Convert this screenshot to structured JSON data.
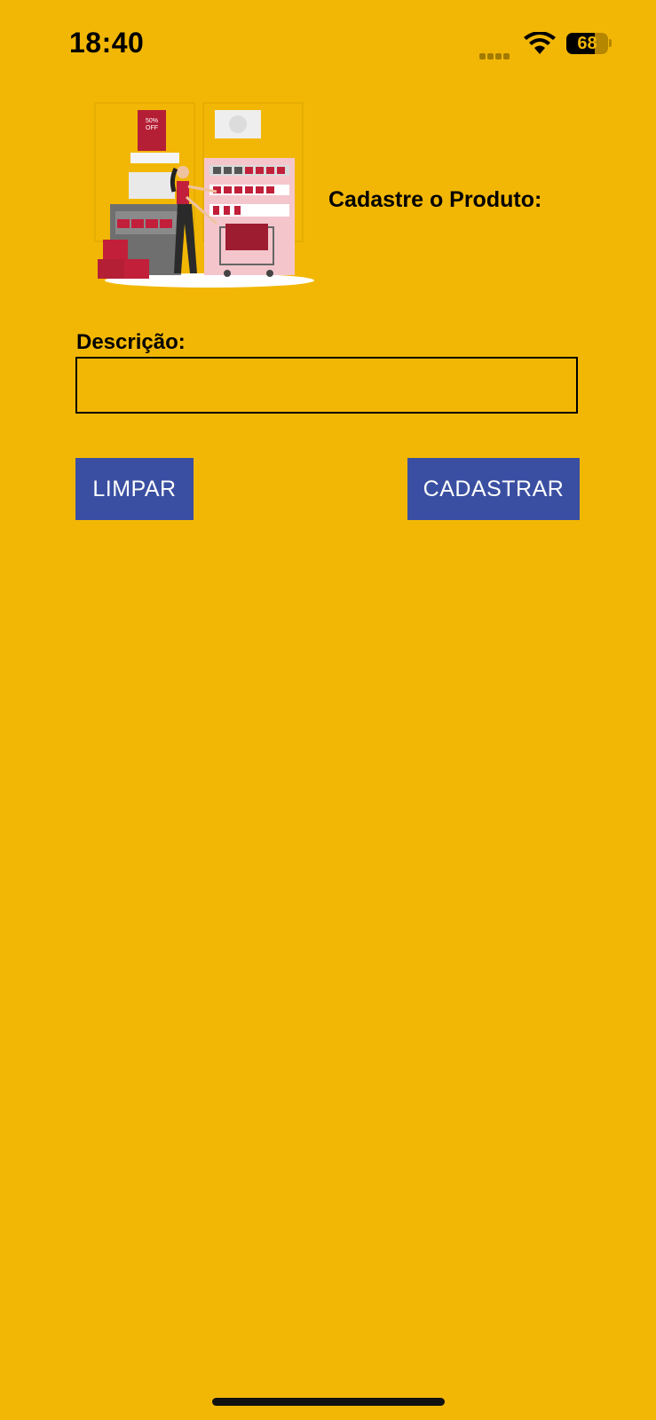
{
  "status_bar": {
    "time": "18:40",
    "battery_percent": "68",
    "icons": [
      "signal-dots-icon",
      "wifi-icon",
      "battery-icon"
    ]
  },
  "hero": {
    "icon": "shopping-illustration",
    "sign_text": "50% OFF"
  },
  "page_title": "Cadastre o Produto:",
  "form": {
    "description_label": "Descrição:",
    "description_value": "",
    "description_placeholder": ""
  },
  "buttons": {
    "clear_label": "LIMPAR",
    "submit_label": "CADASTRAR"
  },
  "colors": {
    "background": "#F2B705",
    "button": "#3A4FA1",
    "button_text": "#FFFFFF",
    "text": "#000000"
  }
}
